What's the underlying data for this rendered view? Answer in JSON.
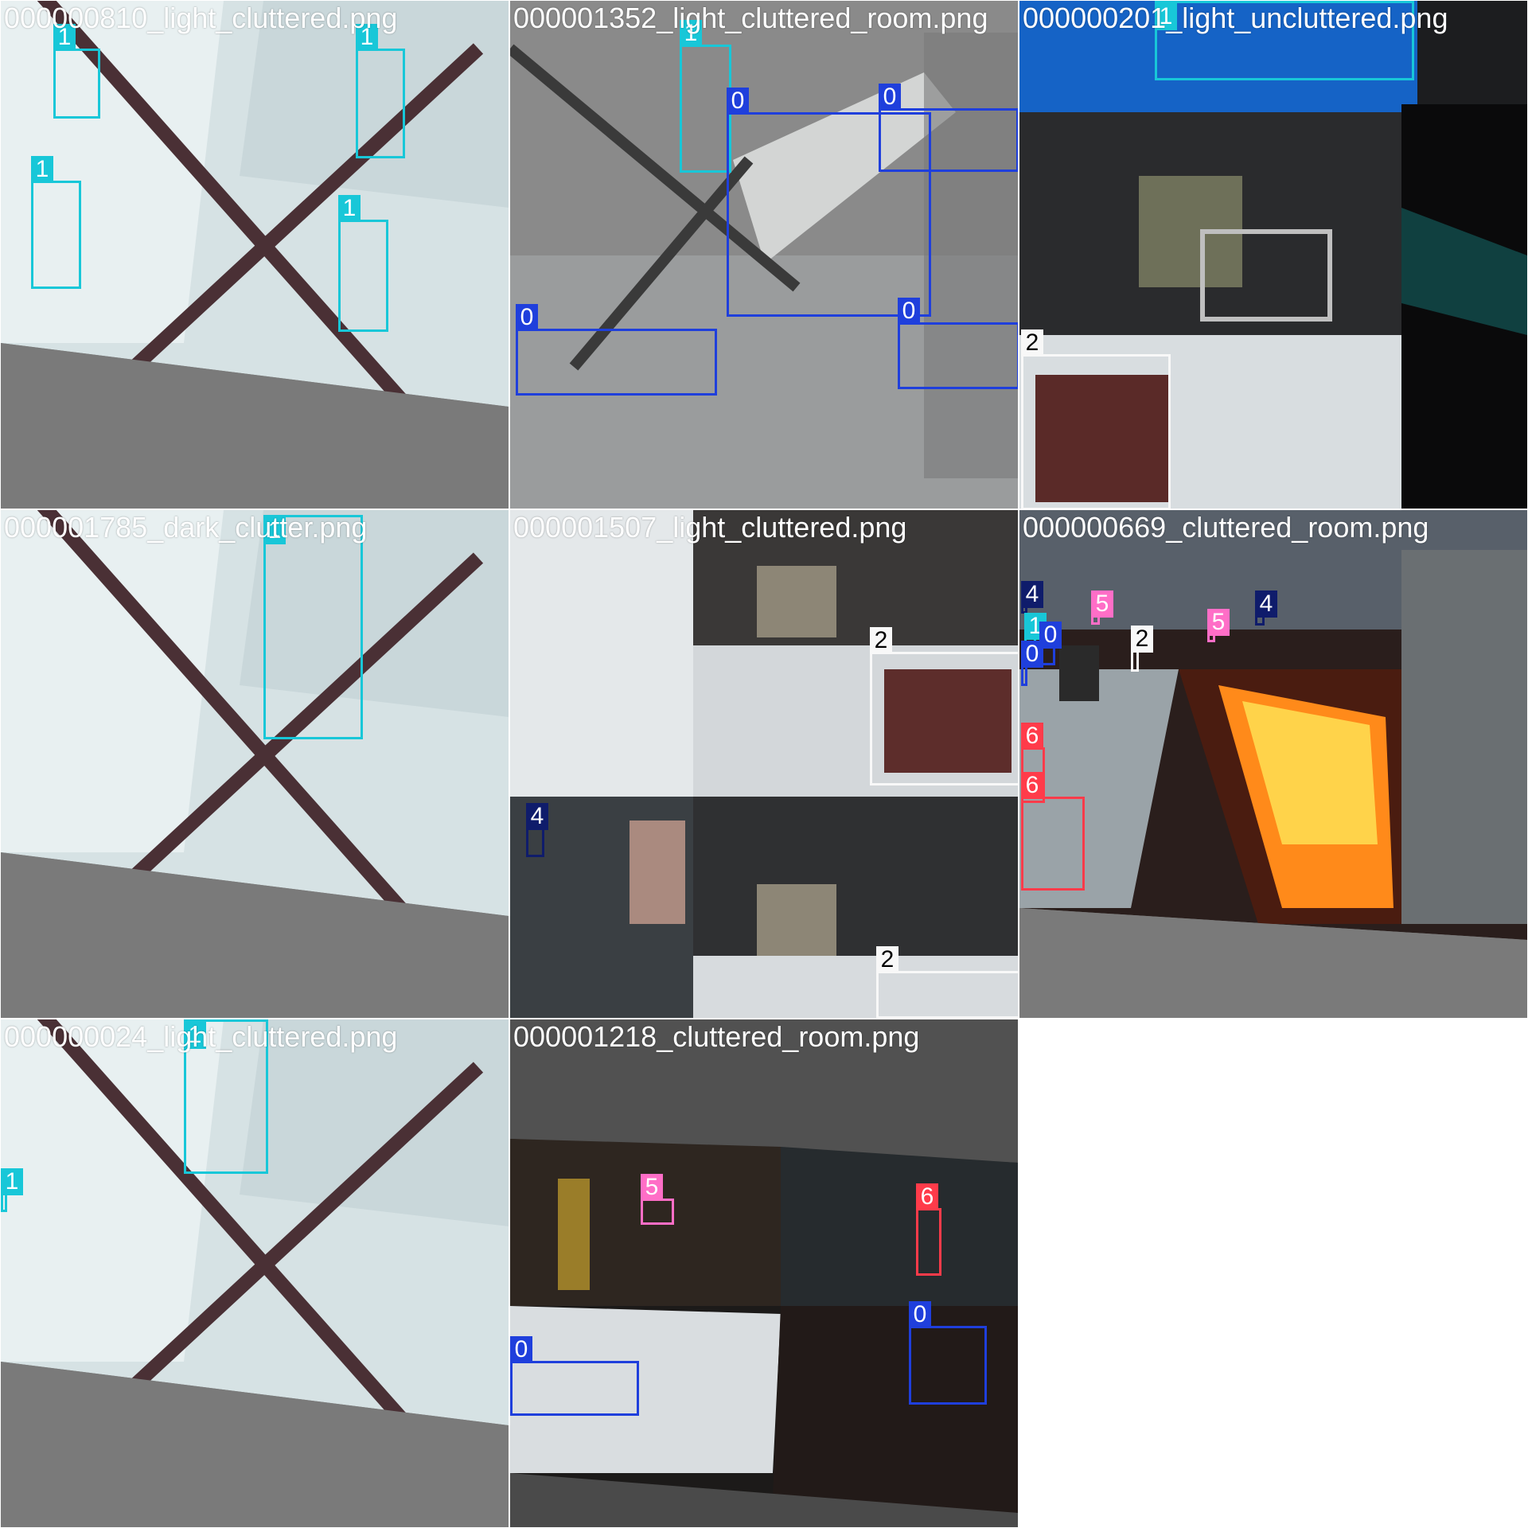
{
  "mosaic": {
    "class_colors": {
      "0": "#1f3fdc",
      "1": "#18c7d8",
      "2": "#f8f8f8",
      "4": "#0f1c6b",
      "5": "#ff6ec7",
      "6": "#ff3b4a"
    },
    "tiles": [
      {
        "name": "tile-000000810",
        "title": "000000810_light_cluttered.png",
        "title_color": "#ffffff",
        "scene": "bright-panels",
        "boxes": [
          {
            "label": "1",
            "cls": "1"
          },
          {
            "label": "1",
            "cls": "1"
          },
          {
            "label": "1",
            "cls": "1"
          },
          {
            "label": "1",
            "cls": "1"
          }
        ]
      },
      {
        "name": "tile-000001352",
        "title": "000001352_light_cluttered_room.png",
        "title_color": "#ffffff",
        "scene": "grey-room",
        "boxes": [
          {
            "label": "1",
            "cls": "1"
          },
          {
            "label": "0",
            "cls": "0"
          },
          {
            "label": "0",
            "cls": "0"
          },
          {
            "label": "0",
            "cls": "0"
          },
          {
            "label": "0",
            "cls": "0"
          }
        ]
      },
      {
        "name": "tile-000000201",
        "title": "000000201_light_uncluttered.png",
        "title_color": "#ffffff",
        "scene": "dark-corridor",
        "boxes": [
          {
            "label": "1",
            "cls": "1"
          },
          {
            "label": "2",
            "cls": "2"
          }
        ]
      },
      {
        "name": "tile-000001785",
        "title": "000001785_dark_clutter.png",
        "title_color": "#ffffff",
        "scene": "bright-panels",
        "boxes": [
          {
            "label": "1",
            "cls": "1"
          }
        ]
      },
      {
        "name": "tile-000001507",
        "title": "000001507_light_cluttered.png",
        "title_color": "#ffffff",
        "scene": "mixed-room",
        "boxes": [
          {
            "label": "2",
            "cls": "2"
          },
          {
            "label": "4",
            "cls": "4"
          },
          {
            "label": "2",
            "cls": "2"
          }
        ]
      },
      {
        "name": "tile-000000669",
        "title": "000000669_cluttered_room.png",
        "title_color": "#ffffff",
        "scene": "orange-room",
        "boxes": [
          {
            "label": "4",
            "cls": "4"
          },
          {
            "label": "5",
            "cls": "5"
          },
          {
            "label": "5",
            "cls": "5"
          },
          {
            "label": "4",
            "cls": "4"
          },
          {
            "label": "1",
            "cls": "1"
          },
          {
            "label": "0",
            "cls": "0"
          },
          {
            "label": "0",
            "cls": "0"
          },
          {
            "label": "2",
            "cls": "2"
          },
          {
            "label": "6",
            "cls": "6"
          },
          {
            "label": "6",
            "cls": "6"
          }
        ]
      },
      {
        "name": "tile-000000024",
        "title": "000000024_light_cluttered.png",
        "title_color": "#ffffff",
        "scene": "bright-panels",
        "boxes": [
          {
            "label": "1",
            "cls": "1"
          },
          {
            "label": "1",
            "cls": "1"
          }
        ]
      },
      {
        "name": "tile-000001218",
        "title": "000001218_cluttered_room.png",
        "title_color": "#ffffff",
        "scene": "dark-room",
        "boxes": [
          {
            "label": "5",
            "cls": "5"
          },
          {
            "label": "6",
            "cls": "6"
          },
          {
            "label": "0",
            "cls": "0"
          },
          {
            "label": "0",
            "cls": "0"
          }
        ]
      }
    ]
  }
}
